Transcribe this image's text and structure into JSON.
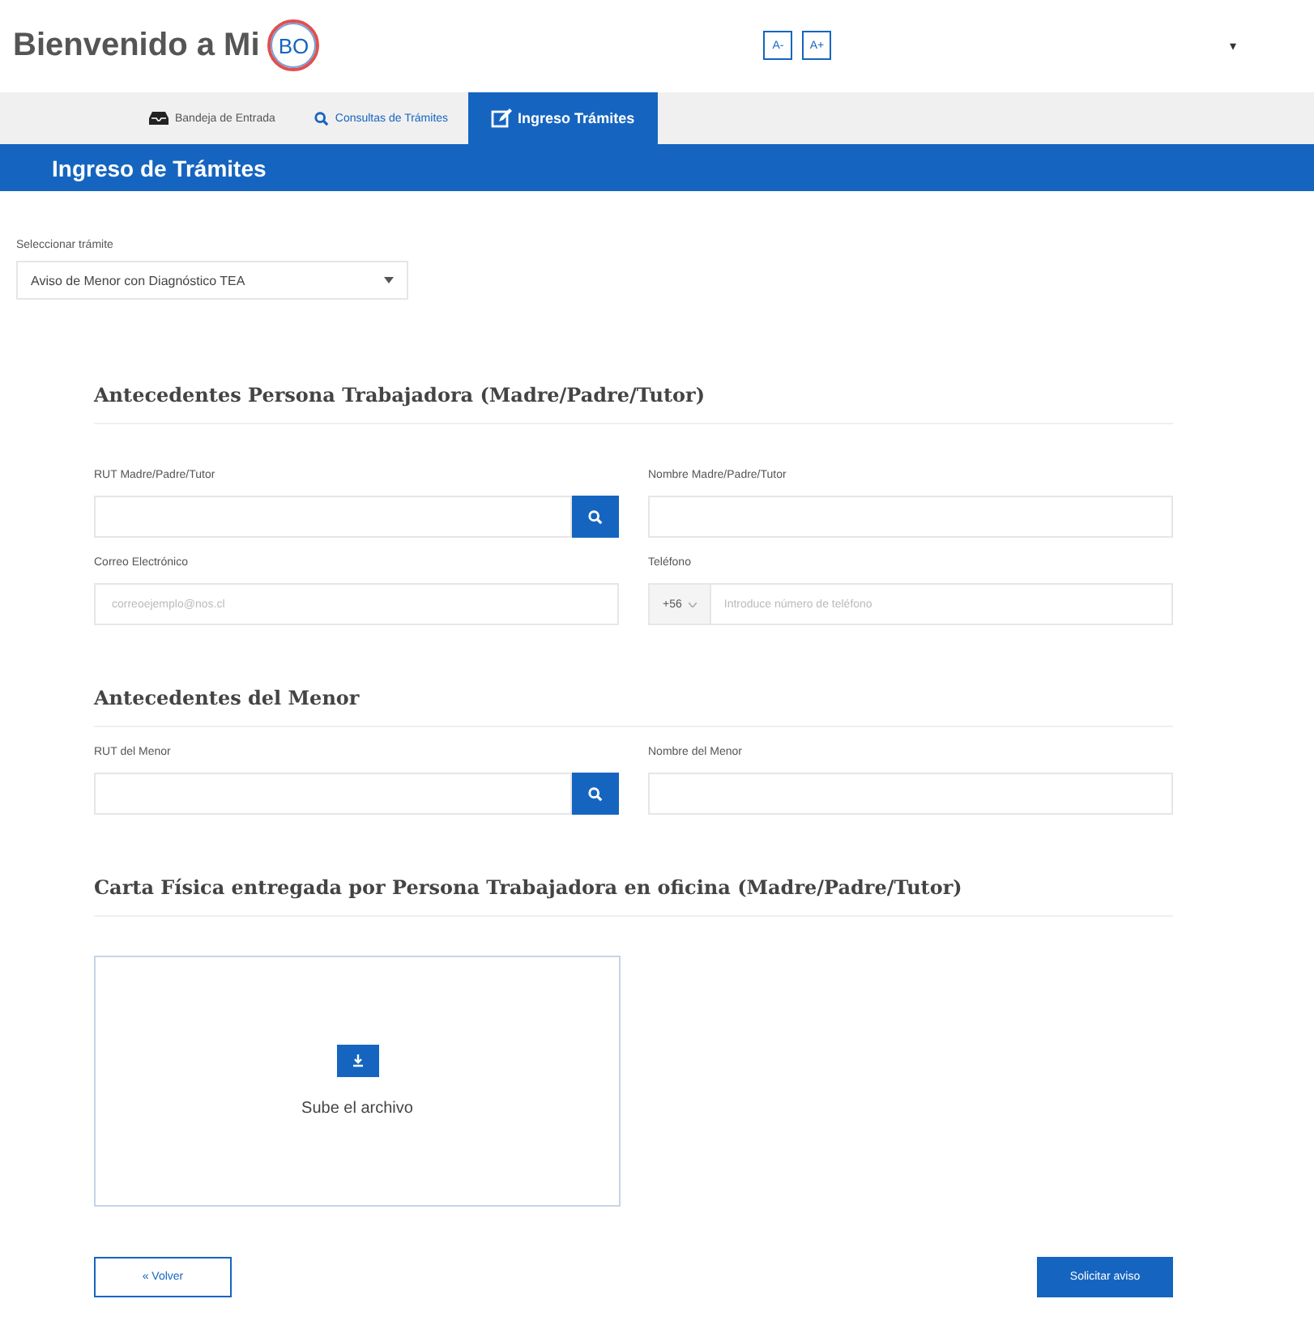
{
  "header": {
    "title": "Bienvenido a Mi",
    "logo": "BO",
    "font_buttons": [
      "A-",
      "A+"
    ],
    "user_caret": "▾"
  },
  "tabs": [
    {
      "label": "Bandeja de Entrada",
      "kind": "inbox",
      "selected": false
    },
    {
      "label": "Consultas de Trámites",
      "kind": "search",
      "selected": false
    },
    {
      "label": "Ingreso Trámites",
      "kind": "edit",
      "selected": true
    }
  ],
  "page_title": "Ingreso de Trámites",
  "tramite_select": {
    "label": "Seleccionar trámite",
    "value": "Aviso de Menor con Diagnóstico TEA"
  },
  "sections": [
    {
      "title": "Antecedentes Persona Trabajadora (Madre/Padre/Tutor)",
      "fields": [
        {
          "label": "RUT Madre/Padre/Tutor",
          "kind": "search"
        },
        {
          "label": "Nombre Madre/Padre/Tutor",
          "kind": "text"
        },
        {
          "label": "Correo Electrónico",
          "kind": "text",
          "placeholder": "correoejemplo@nos.cl"
        },
        {
          "label": "Teléfono",
          "kind": "phone",
          "prefix": "+56",
          "placeholder": "Introduce número de teléfono"
        }
      ]
    },
    {
      "title": "Antecedentes del Menor",
      "fields": [
        {
          "label": "RUT del Menor",
          "kind": "search"
        },
        {
          "label": "Nombre del Menor",
          "kind": "text"
        }
      ]
    },
    {
      "title": "Carta Física entregada por Persona Trabajadora en oficina (Madre/Padre/Tutor)",
      "upload": {
        "label": "Sube el archivo"
      }
    }
  ],
  "buttons": {
    "back": "« Volver",
    "submit": "Solicitar aviso"
  }
}
